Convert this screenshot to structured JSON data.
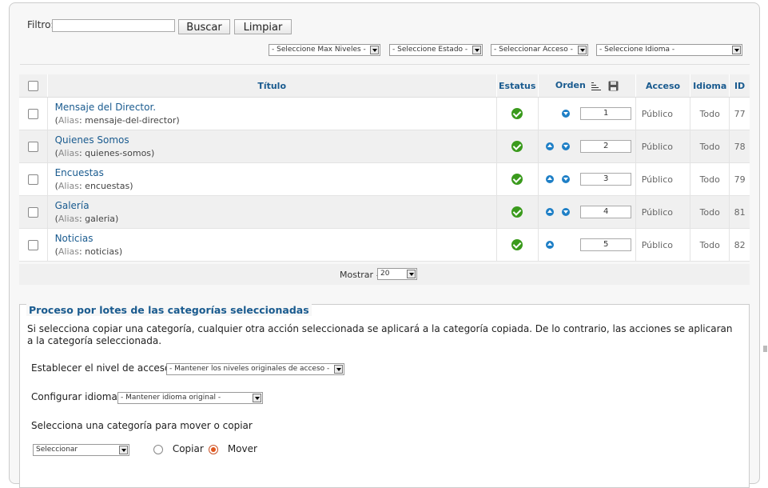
{
  "filter": {
    "label": "Filtro:",
    "value": "",
    "search_button": "Buscar",
    "clear_button": "Limpiar"
  },
  "filters": {
    "max_levels": "- Seleccione Max Niveles -",
    "state": "- Seleccione Estado -",
    "access": "- Seleccionar Acceso -",
    "language": "- Seleccione Idioma -"
  },
  "table": {
    "headers": {
      "title": "Título",
      "status": "Estatus",
      "order": "Orden",
      "access": "Acceso",
      "language": "Idioma",
      "id": "ID"
    },
    "alias_label": "Alias",
    "rows": [
      {
        "title": "Mensaje del Director.",
        "alias": "mensaje-del-director",
        "order": "1",
        "access": "Público",
        "language": "Todo",
        "id": "77"
      },
      {
        "title": "Quienes Somos",
        "alias": "quienes-somos",
        "order": "2",
        "access": "Público",
        "language": "Todo",
        "id": "78"
      },
      {
        "title": "Encuestas",
        "alias": "encuestas",
        "order": "3",
        "access": "Público",
        "language": "Todo",
        "id": "79"
      },
      {
        "title": "Galería",
        "alias": "galeria",
        "order": "4",
        "access": "Público",
        "language": "Todo",
        "id": "81"
      },
      {
        "title": "Noticias",
        "alias": "noticias",
        "order": "5",
        "access": "Público",
        "language": "Todo",
        "id": "82"
      }
    ]
  },
  "pagination": {
    "label": "Mostrar #",
    "value": "20"
  },
  "batch": {
    "legend": "Proceso por lotes de las categorías seleccionadas",
    "description": "Si selecciona copiar una categoría, cualquier otra acción seleccionada se aplicará a la categoría copiada. De lo contrario, las acciones se aplicaran a la categoría seleccionada.",
    "access_label": "Establecer el nivel de acceso",
    "access_value": "- Mantener los niveles originales de acceso -",
    "language_label": "Configurar idioma",
    "language_value": "- Mantener idioma original -",
    "move_label": "Selecciona una categoría para mover o copiar",
    "category_value": "Seleccionar",
    "copy_label": "Copiar",
    "move_option_label": "Mover"
  }
}
